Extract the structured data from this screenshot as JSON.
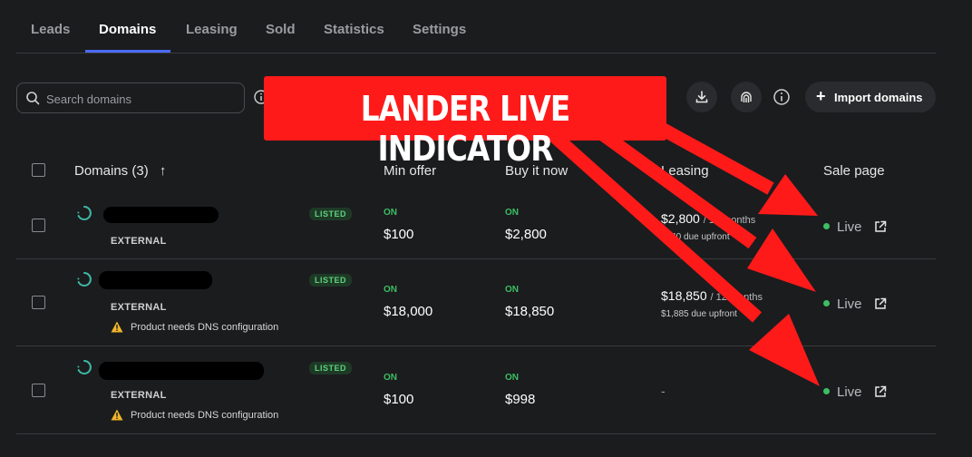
{
  "tabs": [
    {
      "label": "Leads"
    },
    {
      "label": "Domains"
    },
    {
      "label": "Leasing"
    },
    {
      "label": "Sold"
    },
    {
      "label": "Statistics"
    },
    {
      "label": "Settings"
    }
  ],
  "active_tab": "Domains",
  "search": {
    "placeholder": "Search domains",
    "value": ""
  },
  "toolbar": {
    "import_label": "Import domains"
  },
  "table": {
    "headers": {
      "domains": "Domains (3)",
      "sort_arrow": "↑",
      "min_offer": "Min offer",
      "buy_it_now": "Buy it now",
      "leasing": "Leasing",
      "sale_page": "Sale page"
    },
    "rows": [
      {
        "badge": "LISTED",
        "source": "EXTERNAL",
        "warning": "",
        "min_offer_status": "ON",
        "min_offer": "$100",
        "buy_now_status": "ON",
        "buy_now": "$2,800",
        "lease_price": "$2,800",
        "lease_term": "/ 12 months",
        "lease_upfront": "$240 due upfront",
        "sale_page": "Live"
      },
      {
        "badge": "LISTED",
        "source": "EXTERNAL",
        "warning": "Product needs DNS configuration",
        "min_offer_status": "ON",
        "min_offer": "$18,000",
        "buy_now_status": "ON",
        "buy_now": "$18,850",
        "lease_price": "$18,850",
        "lease_term": "/ 12 months",
        "lease_upfront": "$1,885 due upfront",
        "sale_page": "Live"
      },
      {
        "badge": "LISTED",
        "source": "EXTERNAL",
        "warning": "Product needs DNS configuration",
        "min_offer_status": "ON",
        "min_offer": "$100",
        "buy_now_status": "ON",
        "buy_now": "$998",
        "lease_dash": "-",
        "sale_page": "Live"
      }
    ]
  },
  "annotation": {
    "text": "LANDER LIVE INDICATOR",
    "color": "#ff1a1a"
  },
  "colors": {
    "accent": "#4b6bfb",
    "live_green": "#3cbf63",
    "badge_bg": "#1e3a26"
  },
  "icons": [
    "search-icon",
    "info-icon",
    "download-icon",
    "fingerprint-icon",
    "plus-icon",
    "spinner-icon",
    "warning-icon",
    "external-link-icon",
    "sort-up-icon"
  ]
}
